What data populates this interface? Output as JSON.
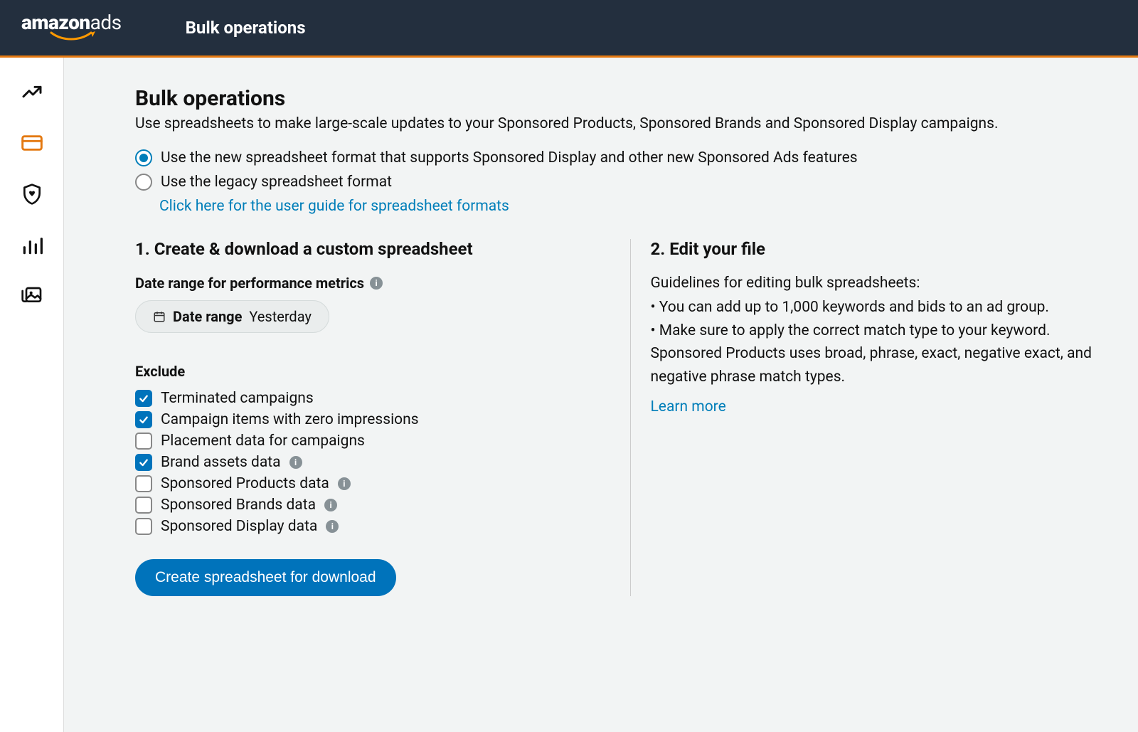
{
  "header": {
    "brand_amazon": "amazon",
    "brand_ads": "ads",
    "title": "Bulk operations"
  },
  "page": {
    "title": "Bulk operations",
    "subtitle": "Use spreadsheets to make large-scale updates to your Sponsored Products, Sponsored Brands and Sponsored Display campaigns."
  },
  "format_options": {
    "new_label": "Use the new spreadsheet format that supports Sponsored Display and other new Sponsored Ads features",
    "legacy_label": "Use the legacy spreadsheet format",
    "guide_link": "Click here for the user guide for spreadsheet formats",
    "selected": "new"
  },
  "section1": {
    "heading": "1. Create & download a custom spreadsheet",
    "date_range_label": "Date range for performance metrics",
    "date_pill_lead": "Date range",
    "date_pill_value": "Yesterday",
    "exclude_label": "Exclude",
    "exclude_options": [
      {
        "label": "Terminated campaigns",
        "checked": true,
        "info": false
      },
      {
        "label": "Campaign items with zero impressions",
        "checked": true,
        "info": false
      },
      {
        "label": "Placement data for campaigns",
        "checked": false,
        "info": false
      },
      {
        "label": "Brand assets data",
        "checked": true,
        "info": true
      },
      {
        "label": "Sponsored Products data",
        "checked": false,
        "info": true
      },
      {
        "label": "Sponsored Brands data",
        "checked": false,
        "info": true
      },
      {
        "label": "Sponsored Display data",
        "checked": false,
        "info": true
      }
    ],
    "create_button": "Create spreadsheet for download"
  },
  "section2": {
    "heading": "2. Edit your file",
    "intro": "Guidelines for editing bulk spreadsheets:",
    "bullets": [
      "You can add up to 1,000 keywords and bids to an ad group.",
      "Make sure to apply the correct match type to your keyword. Sponsored Products uses broad, phrase, exact, negative exact, and negative phrase match types."
    ],
    "learn_more": "Learn more"
  }
}
